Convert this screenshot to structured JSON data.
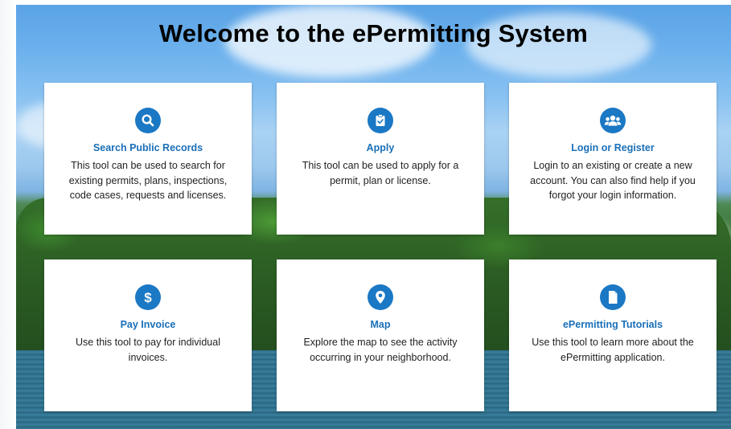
{
  "header": {
    "title": "Welcome to the ePermitting System"
  },
  "cards": [
    {
      "icon": "search-icon",
      "title": "Search Public Records",
      "description": "This tool can be used to search for existing permits, plans, inspections, code cases, requests and licenses."
    },
    {
      "icon": "clipboard-check-icon",
      "title": "Apply",
      "description": "This tool can be used to apply for a permit, plan or license."
    },
    {
      "icon": "users-icon",
      "title": "Login or Register",
      "description": "Login to an existing or create a new account. You can also find help if you forgot your login information."
    },
    {
      "icon": "dollar-icon",
      "title": "Pay Invoice",
      "description": "Use this tool to pay for individual invoices."
    },
    {
      "icon": "map-pin-icon",
      "title": "Map",
      "description": "Explore the map to see the activity occurring in your neighborhood."
    },
    {
      "icon": "document-icon",
      "title": "ePermitting Tutorials",
      "description": "Use this tool to learn more about the ePermitting application."
    }
  ],
  "colors": {
    "accent": "#1b78c4",
    "card_title": "#1a6fb8",
    "card_bg": "#ffffff"
  }
}
